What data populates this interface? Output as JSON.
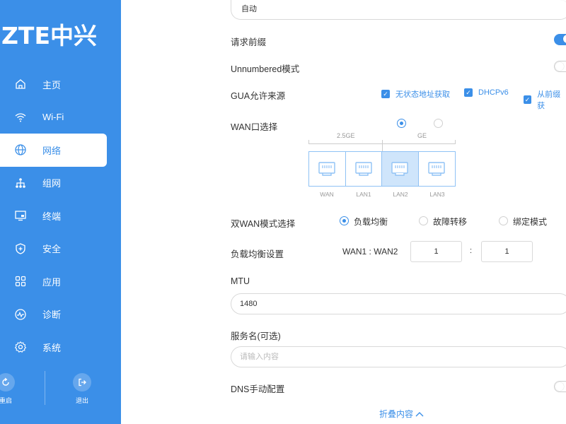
{
  "brand": {
    "logo_text": "ZTE中兴"
  },
  "sidebar": {
    "items": [
      {
        "label": "主页",
        "icon": "home-icon"
      },
      {
        "label": "Wi-Fi",
        "icon": "wifi-icon"
      },
      {
        "label": "网络",
        "icon": "globe-icon",
        "active": true
      },
      {
        "label": "组网",
        "icon": "network-icon"
      },
      {
        "label": "终端",
        "icon": "monitor-icon"
      },
      {
        "label": "安全",
        "icon": "shield-icon"
      },
      {
        "label": "应用",
        "icon": "apps-icon"
      },
      {
        "label": "诊断",
        "icon": "diagnose-icon"
      },
      {
        "label": "系统",
        "icon": "gear-icon"
      }
    ],
    "actions": {
      "restart_label": "重启",
      "logout_label": "退出"
    }
  },
  "form": {
    "mode_select": {
      "value": "自动"
    },
    "request_prefix": {
      "label": "请求前缀",
      "enabled": true
    },
    "unnumbered": {
      "label": "Unnumbered模式",
      "enabled": false
    },
    "gua_source": {
      "label": "GUA允许来源",
      "options": [
        "无状态地址获取",
        "DHCPv6",
        "从前缀获"
      ]
    },
    "wan_select": {
      "label": "WAN口选择",
      "group_25ge": "2.5GE",
      "group_ge": "GE",
      "ports": [
        "WAN",
        "LAN1",
        "LAN2",
        "LAN3"
      ],
      "selected_port": "LAN2"
    },
    "dual_wan": {
      "label": "双WAN模式选择",
      "options": [
        "负载均衡",
        "故障转移",
        "绑定模式"
      ],
      "selected": "负载均衡"
    },
    "load_balance": {
      "label": "负载均衡设置",
      "ratio_label": "WAN1 : WAN2",
      "wan1": "1",
      "separator": ":",
      "wan2": "1"
    },
    "mtu": {
      "label": "MTU",
      "value": "1480"
    },
    "service_name": {
      "label": "服务名(可选)",
      "placeholder": "请输入内容"
    },
    "dns_manual": {
      "label": "DNS手动配置",
      "enabled": false
    },
    "collapse_label": "折叠内容"
  },
  "colors": {
    "accent": "#3b8fe8",
    "port_selected": "#cfe5fb"
  }
}
